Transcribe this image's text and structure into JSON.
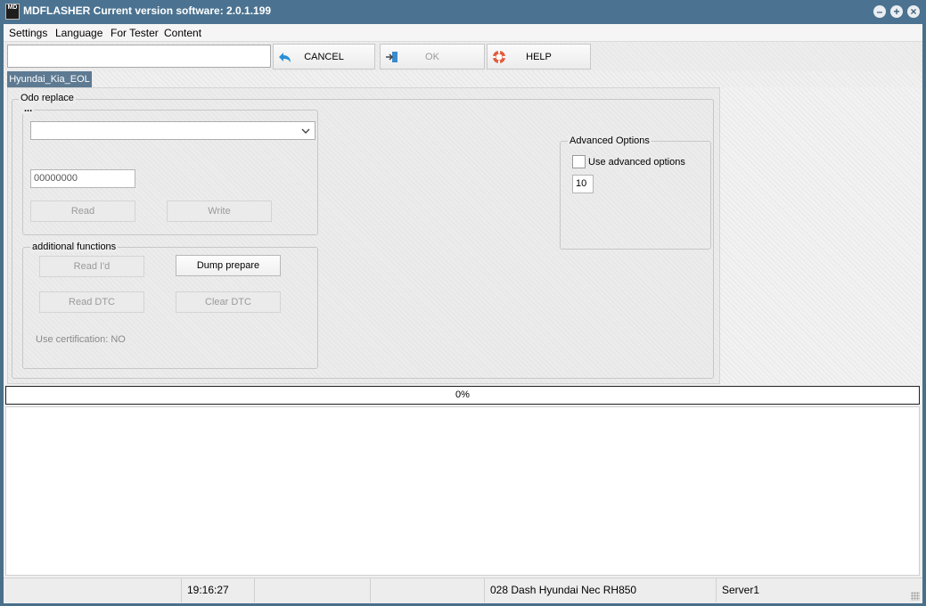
{
  "window": {
    "icon_text": "MD",
    "title": "MDFLASHER  Current version software: 2.0.1.199",
    "min_glyph": "–",
    "max_glyph": "+",
    "close_glyph": "×"
  },
  "menu": [
    "Settings",
    "Language",
    "For Tester",
    "Content"
  ],
  "toolbar": {
    "path_value": "",
    "cancel_label": "CANCEL",
    "ok_label": "OK",
    "help_label": "HELP"
  },
  "tab": {
    "label": "Hyundai_Kia_EOL"
  },
  "odo_group": {
    "title": "Odo replace",
    "subgroup_title": "...",
    "combo_value": "",
    "field_value": "00000000",
    "read_label": "Read",
    "write_label": "Write"
  },
  "additional": {
    "title": "additional functions",
    "read_id_label": "Read I'd",
    "dump_prepare_label": "Dump prepare",
    "read_dtc_label": "Read DTC",
    "clear_dtc_label": "Clear DTC",
    "certification_text": "Use certification: NO"
  },
  "advanced": {
    "title": "Advanced Options",
    "checkbox_label": "Use advanced options",
    "checkbox_checked": false,
    "value": "10"
  },
  "progress": {
    "percent": 0,
    "label": "0%"
  },
  "status": {
    "time": "19:16:27",
    "device": "028 Dash Hyundai Nec RH850",
    "server": "Server1"
  }
}
